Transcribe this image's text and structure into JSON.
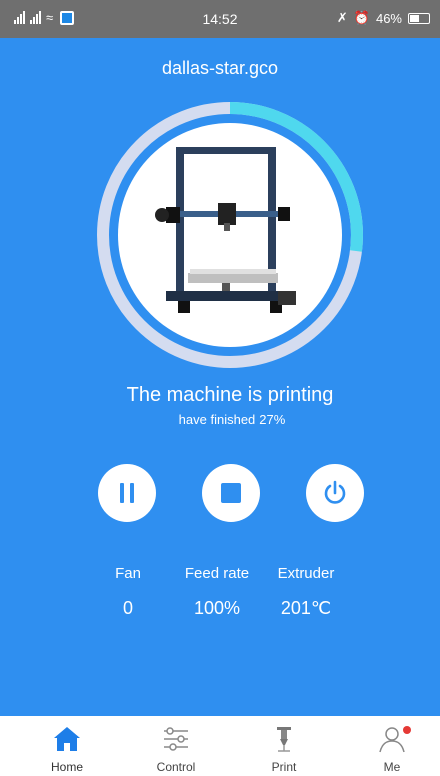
{
  "status_bar": {
    "signal_text": "atl",
    "time": "14:52",
    "battery": "46%"
  },
  "job": {
    "file_name": "dallas-star.gco",
    "progress": 0.27
  },
  "status": {
    "title": "The machine is printing",
    "sub_label": "have finished",
    "sub_value": "27%"
  },
  "controls": {
    "pause_icon": "pause-icon",
    "stop_icon": "stop-icon",
    "power_icon": "power-icon"
  },
  "stats": {
    "fan": {
      "label": "Fan",
      "value": "0"
    },
    "feed_rate": {
      "label": "Feed rate",
      "value": "100%"
    },
    "extruder": {
      "label": "Extruder",
      "value": "201℃"
    }
  },
  "nav": {
    "items": [
      {
        "label": "Home",
        "icon": "home-icon"
      },
      {
        "label": "Control",
        "icon": "sliders-icon"
      },
      {
        "label": "Print",
        "icon": "nozzle-icon"
      },
      {
        "label": "Me",
        "icon": "person-icon"
      }
    ]
  },
  "colors": {
    "background": "#2f8ff0",
    "progress": "#4fd8ee",
    "track": "#d4dcf0"
  }
}
